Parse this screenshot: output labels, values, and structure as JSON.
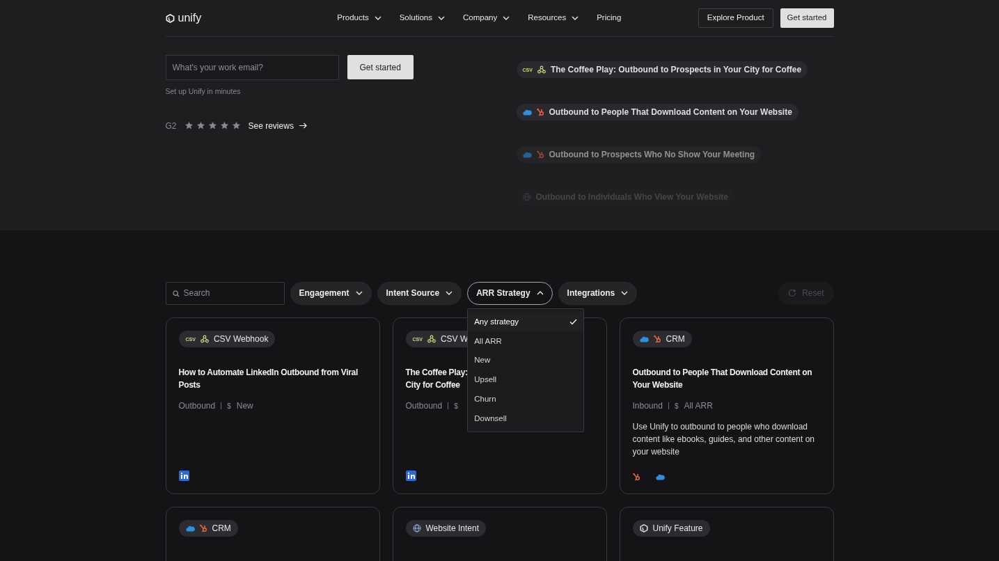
{
  "nav": {
    "logo": "unify",
    "links": [
      {
        "label": "Products",
        "has_menu": true
      },
      {
        "label": "Solutions",
        "has_menu": true
      },
      {
        "label": "Company",
        "has_menu": true
      },
      {
        "label": "Resources",
        "has_menu": true
      },
      {
        "label": "Pricing",
        "has_menu": false
      }
    ],
    "explore": "Explore Product",
    "cta": "Get started"
  },
  "hero": {
    "email_placeholder": "What's your work email?",
    "cta": "Get started",
    "note": "Set up Unify in minutes",
    "rating_label": "G2",
    "stars": 5,
    "reviews_link": "See reviews"
  },
  "pills": [
    {
      "kind": "csv-webhook",
      "csv_label": "CSV",
      "text": "The Coffee Play: Outbound to Prospects in Your City for Coffee",
      "dimmed": false,
      "faded": false
    },
    {
      "kind": "crm",
      "text": "Outbound to People That Download Content on Your Website",
      "dimmed": false,
      "faded": false
    },
    {
      "kind": "crm",
      "text": "Outbound to Prospects Who No Show Your Meeting",
      "dimmed": true,
      "faded": false
    },
    {
      "kind": "website",
      "text": "Outbound to Individuals Who View Your Website",
      "dimmed": false,
      "faded": true
    }
  ],
  "filters": {
    "search_placeholder": "Search",
    "items": [
      {
        "label": "Engagement",
        "expanded": false
      },
      {
        "label": "Intent Source",
        "expanded": false
      },
      {
        "label": "ARR Strategy",
        "expanded": true
      },
      {
        "label": "Integrations",
        "expanded": false
      }
    ],
    "reset": "Reset",
    "reset_disabled": true,
    "menu": [
      {
        "label": "Any strategy",
        "selected": true
      },
      {
        "label": "All ARR",
        "selected": false
      },
      {
        "label": "New",
        "selected": false
      },
      {
        "label": "Upsell",
        "selected": false
      },
      {
        "label": "Churn",
        "selected": false
      },
      {
        "label": "Downsell",
        "selected": false
      }
    ]
  },
  "cards": [
    {
      "badge": {
        "kind": "csv-webhook",
        "csv_label": "CSV",
        "text": "CSV Webhook"
      },
      "title": [
        "How to Automate LinkedIn Outbound from Viral Posts"
      ],
      "category": "Outbound",
      "currency": "$",
      "arr": "New",
      "footer": {
        "kind": "linkedin"
      }
    },
    {
      "badge": {
        "kind": "csv-webhook",
        "csv_label": "CSV",
        "text": "CSV W"
      },
      "title": [
        "The Coffee Play:",
        "City for Coffee"
      ],
      "category": "Outbound",
      "currency": "$",
      "footer": {
        "kind": "linkedin"
      }
    },
    {
      "badge": {
        "kind": "crm",
        "text": "CRM"
      },
      "title": [
        "Outbound to People That Download Content on Your Website"
      ],
      "category": "Inbound",
      "currency": "$",
      "arr": "All ARR",
      "description": "Use Unify to outbound to people who download content like ebooks, guides, and other content on your website",
      "footer": {
        "kind": "crm"
      }
    },
    {
      "badge": {
        "kind": "crm",
        "text": "CRM"
      }
    },
    {
      "badge": {
        "kind": "website",
        "text": "Website Intent"
      }
    },
    {
      "badge": {
        "kind": "unify",
        "text": "Unify Feature"
      }
    }
  ]
}
